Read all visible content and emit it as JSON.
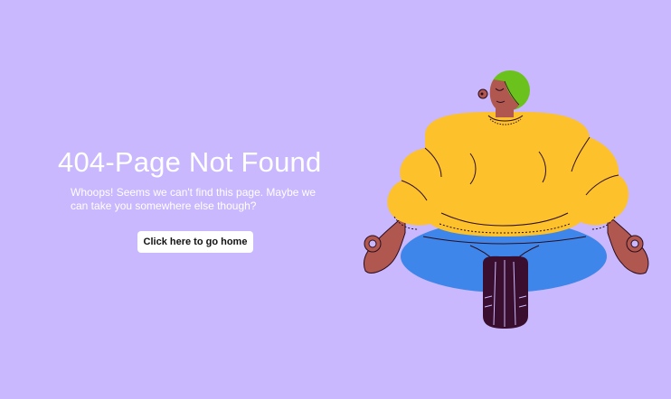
{
  "title": "404-Page Not Found",
  "message": "Whoops! Seems we can't find this page. Maybe we can take you somewhere else though?",
  "home_button_label": "Click here to go home",
  "colors": {
    "background": "#c9b8fd",
    "text": "#ffffff",
    "button_bg": "#ffffff",
    "sweater": "#fdc12c",
    "pants": "#3e86ea",
    "skin": "#b0574f",
    "hair": "#6cc21c",
    "sock": "#3a0e2f"
  }
}
